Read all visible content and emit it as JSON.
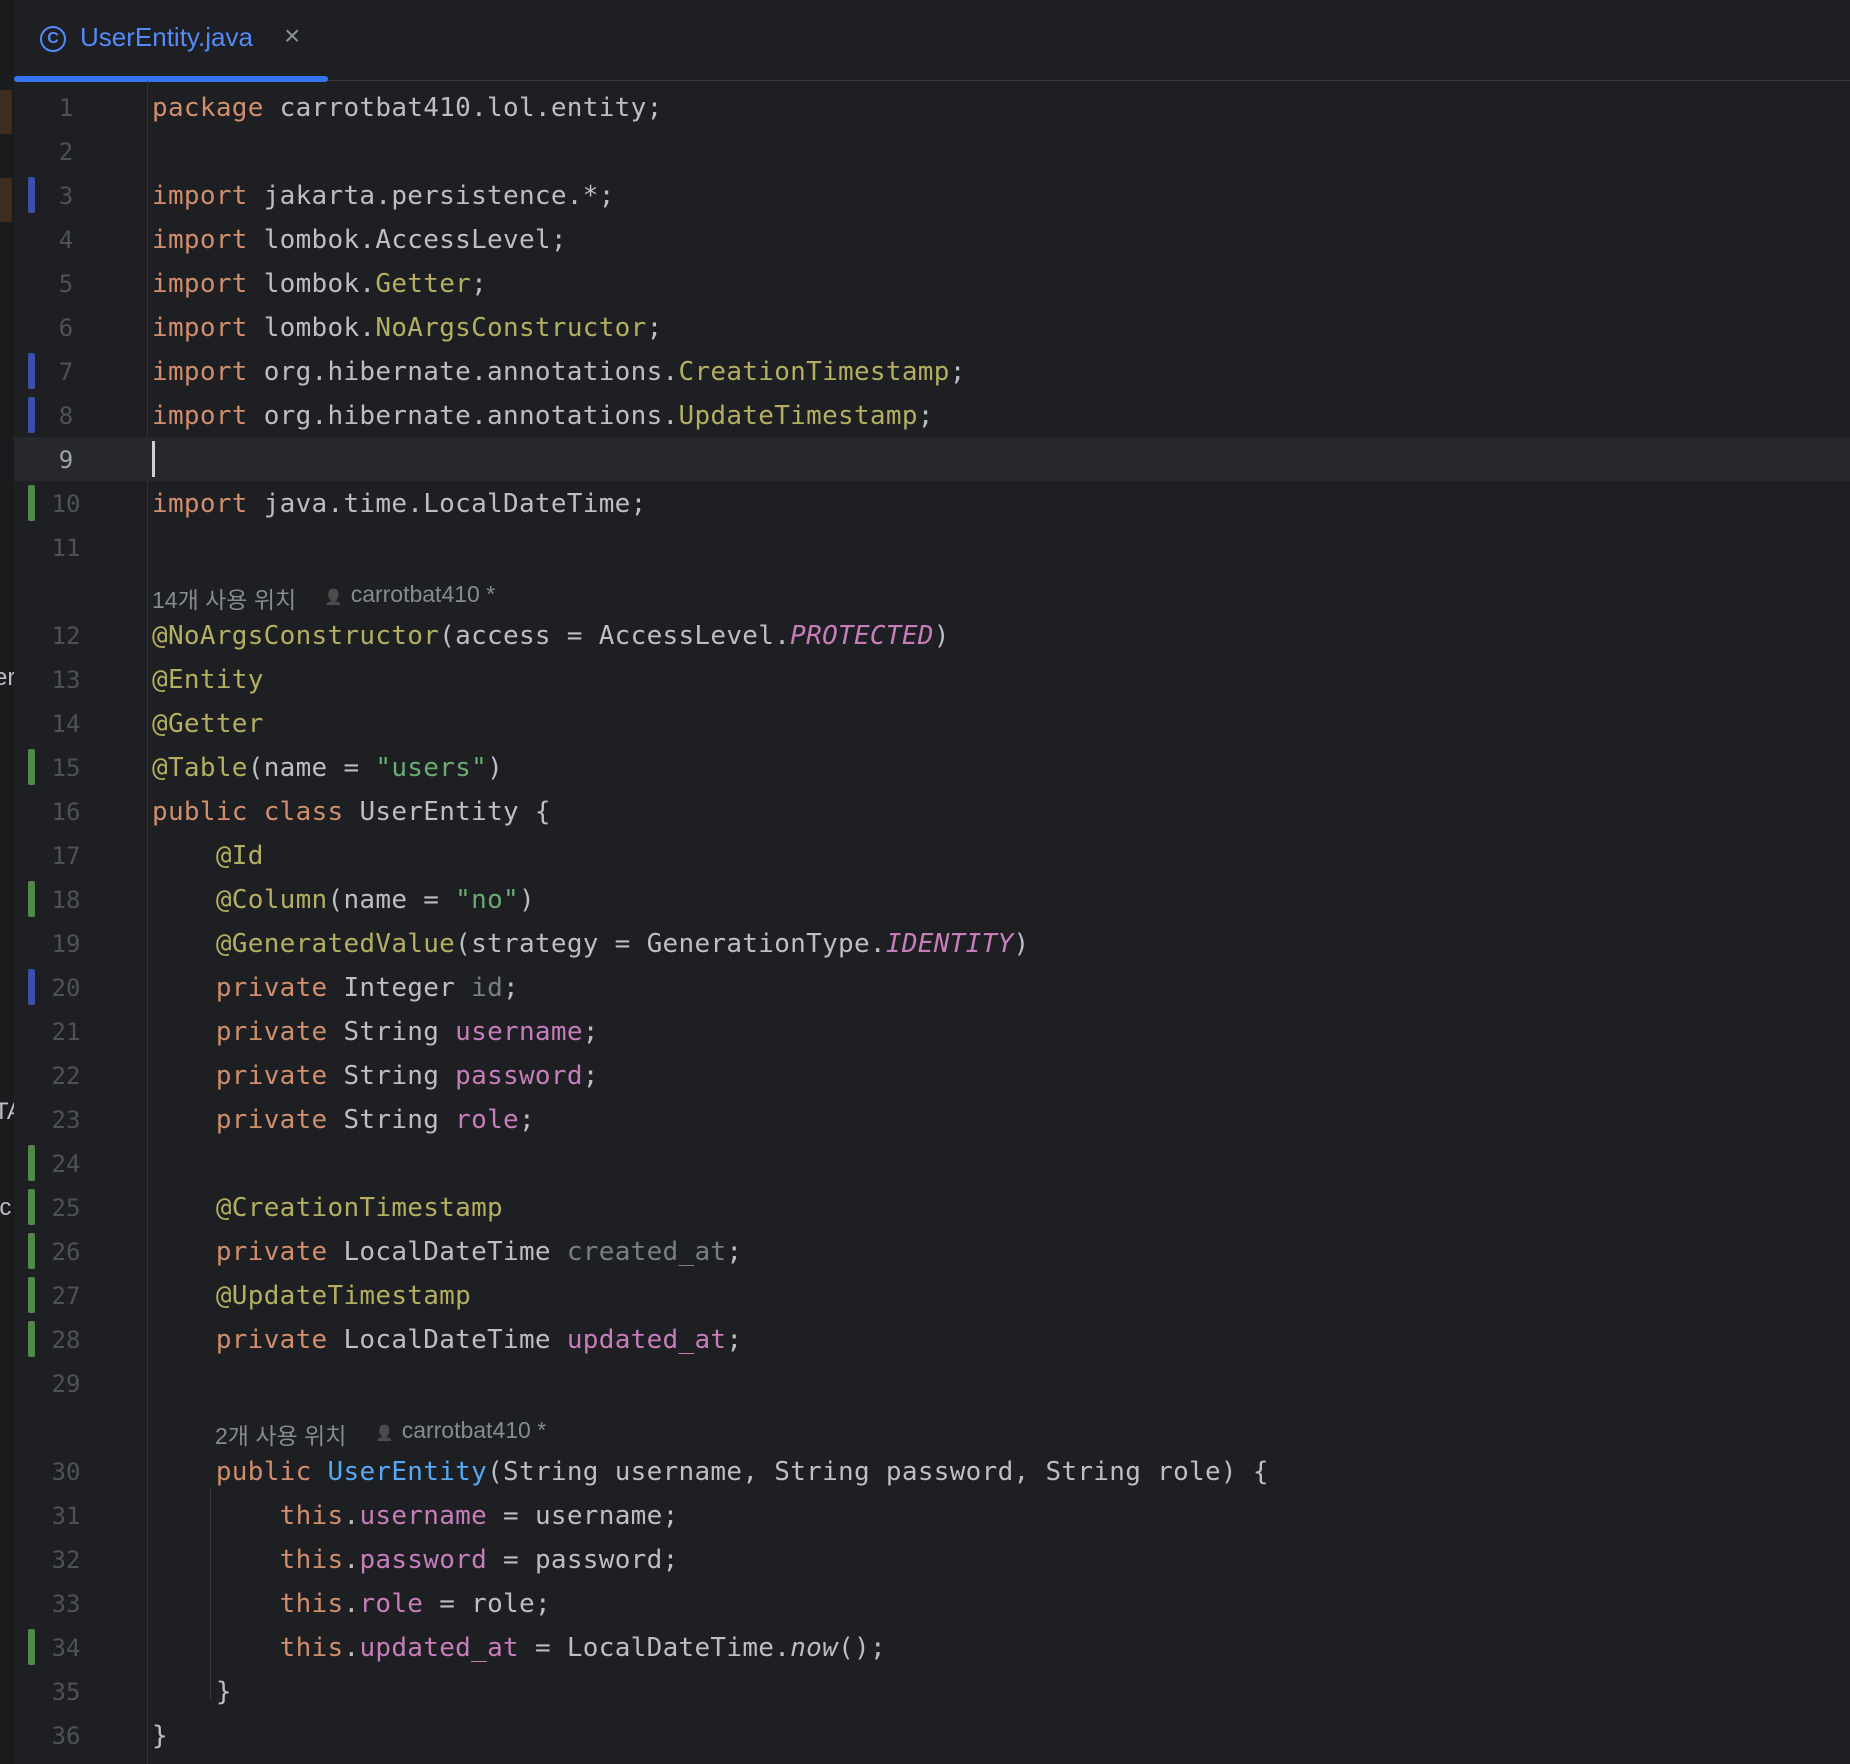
{
  "tab": {
    "icon": "C",
    "title": "UserEntity.java",
    "close": "×"
  },
  "left_clipped_text": [
    "er",
    "TA",
    "ic"
  ],
  "hints": [
    {
      "usages": "14개 사용 위치",
      "author": "carrotbat410 *"
    },
    {
      "usages": "2개 사용 위치",
      "author": "carrotbat410 *"
    }
  ],
  "line_numbers": [
    "1",
    "2",
    "3",
    "4",
    "5",
    "6",
    "7",
    "8",
    "9",
    "10",
    "11",
    "12",
    "13",
    "14",
    "15",
    "16",
    "17",
    "18",
    "19",
    "20",
    "21",
    "22",
    "23",
    "24",
    "25",
    "26",
    "27",
    "28",
    "29",
    "30",
    "31",
    "32",
    "33",
    "34",
    "35",
    "36"
  ],
  "code": [
    [
      {
        "t": "package",
        "c": "kw"
      },
      {
        "t": " carrotbat410.lol.entity;"
      }
    ],
    [],
    [
      {
        "t": "import",
        "c": "kw"
      },
      {
        "t": " jakarta.persistence.*;"
      }
    ],
    [
      {
        "t": "import",
        "c": "kw"
      },
      {
        "t": " lombok.AccessLevel;"
      }
    ],
    [
      {
        "t": "import",
        "c": "kw"
      },
      {
        "t": " lombok."
      },
      {
        "t": "Getter",
        "c": "ann"
      },
      {
        "t": ";"
      }
    ],
    [
      {
        "t": "import",
        "c": "kw"
      },
      {
        "t": " lombok."
      },
      {
        "t": "NoArgsConstructor",
        "c": "ann"
      },
      {
        "t": ";"
      }
    ],
    [
      {
        "t": "import",
        "c": "kw"
      },
      {
        "t": " org.hibernate.annotations."
      },
      {
        "t": "CreationTimestamp",
        "c": "ann"
      },
      {
        "t": ";"
      }
    ],
    [
      {
        "t": "import",
        "c": "kw"
      },
      {
        "t": " org.hibernate.annotations."
      },
      {
        "t": "UpdateTimestamp",
        "c": "ann"
      },
      {
        "t": ";"
      }
    ],
    [],
    [
      {
        "t": "import",
        "c": "kw"
      },
      {
        "t": " java.time.LocalDateTime;"
      }
    ],
    [],
    [
      {
        "t": "@NoArgsConstructor",
        "c": "ann"
      },
      {
        "t": "(access = AccessLevel."
      },
      {
        "t": "PROTECTED",
        "c": "const"
      },
      {
        "t": ")"
      }
    ],
    [
      {
        "t": "@Entity",
        "c": "ann"
      }
    ],
    [
      {
        "t": "@Getter",
        "c": "ann"
      }
    ],
    [
      {
        "t": "@Table",
        "c": "ann"
      },
      {
        "t": "(name = "
      },
      {
        "t": "\"users\"",
        "c": "str"
      },
      {
        "t": ")"
      }
    ],
    [
      {
        "t": "public",
        "c": "kw"
      },
      {
        "t": " "
      },
      {
        "t": "class",
        "c": "kw"
      },
      {
        "t": " UserEntity {"
      }
    ],
    [
      {
        "t": "    "
      },
      {
        "t": "@Id",
        "c": "ann"
      }
    ],
    [
      {
        "t": "    "
      },
      {
        "t": "@Column",
        "c": "ann"
      },
      {
        "t": "(name = "
      },
      {
        "t": "\"no\"",
        "c": "str"
      },
      {
        "t": ")"
      }
    ],
    [
      {
        "t": "    "
      },
      {
        "t": "@GeneratedValue",
        "c": "ann"
      },
      {
        "t": "(strategy = GenerationType."
      },
      {
        "t": "IDENTITY",
        "c": "const"
      },
      {
        "t": ")"
      }
    ],
    [
      {
        "t": "    "
      },
      {
        "t": "private",
        "c": "kw"
      },
      {
        "t": " Integer "
      },
      {
        "t": "id",
        "c": "unused"
      },
      {
        "t": ";"
      }
    ],
    [
      {
        "t": "    "
      },
      {
        "t": "private",
        "c": "kw"
      },
      {
        "t": " String "
      },
      {
        "t": "username",
        "c": "fld"
      },
      {
        "t": ";"
      }
    ],
    [
      {
        "t": "    "
      },
      {
        "t": "private",
        "c": "kw"
      },
      {
        "t": " String "
      },
      {
        "t": "password",
        "c": "fld"
      },
      {
        "t": ";"
      }
    ],
    [
      {
        "t": "    "
      },
      {
        "t": "private",
        "c": "kw"
      },
      {
        "t": " String "
      },
      {
        "t": "role",
        "c": "fld"
      },
      {
        "t": ";"
      }
    ],
    [],
    [
      {
        "t": "    "
      },
      {
        "t": "@CreationTimestamp",
        "c": "ann"
      }
    ],
    [
      {
        "t": "    "
      },
      {
        "t": "private",
        "c": "kw"
      },
      {
        "t": " LocalDateTime "
      },
      {
        "t": "created_at",
        "c": "unused"
      },
      {
        "t": ";"
      }
    ],
    [
      {
        "t": "    "
      },
      {
        "t": "@UpdateTimestamp",
        "c": "ann"
      }
    ],
    [
      {
        "t": "    "
      },
      {
        "t": "private",
        "c": "kw"
      },
      {
        "t": " LocalDateTime "
      },
      {
        "t": "updated_at",
        "c": "fld"
      },
      {
        "t": ";"
      }
    ],
    [],
    [
      {
        "t": "    "
      },
      {
        "t": "public",
        "c": "kw"
      },
      {
        "t": " "
      },
      {
        "t": "UserEntity",
        "c": "fn"
      },
      {
        "t": "(String username, String password, String role) {"
      }
    ],
    [
      {
        "t": "        "
      },
      {
        "t": "this",
        "c": "kw"
      },
      {
        "t": "."
      },
      {
        "t": "username",
        "c": "fld"
      },
      {
        "t": " = username;"
      }
    ],
    [
      {
        "t": "        "
      },
      {
        "t": "this",
        "c": "kw"
      },
      {
        "t": "."
      },
      {
        "t": "password",
        "c": "fld"
      },
      {
        "t": " = password;"
      }
    ],
    [
      {
        "t": "        "
      },
      {
        "t": "this",
        "c": "kw"
      },
      {
        "t": "."
      },
      {
        "t": "role",
        "c": "fld"
      },
      {
        "t": " = role;"
      }
    ],
    [
      {
        "t": "        "
      },
      {
        "t": "this",
        "c": "kw"
      },
      {
        "t": "."
      },
      {
        "t": "updated_at",
        "c": "fld"
      },
      {
        "t": " = LocalDateTime."
      },
      {
        "t": "now",
        "c": "ital"
      },
      {
        "t": "();"
      }
    ],
    [
      {
        "t": "    }"
      }
    ],
    [
      {
        "t": "}"
      }
    ]
  ],
  "vcs_markers": {
    "modified": [
      3,
      7,
      8,
      20
    ],
    "added": [
      10,
      15,
      18,
      24,
      25,
      26,
      27,
      28,
      34
    ]
  },
  "current_line": 9,
  "theme": {
    "background": "#1e1f22",
    "keyword": "#cf8e6d",
    "annotation": "#b3ae60",
    "string": "#6aab73",
    "field": "#c77dbb",
    "function": "#56a8f5",
    "accent": "#3574f0"
  }
}
